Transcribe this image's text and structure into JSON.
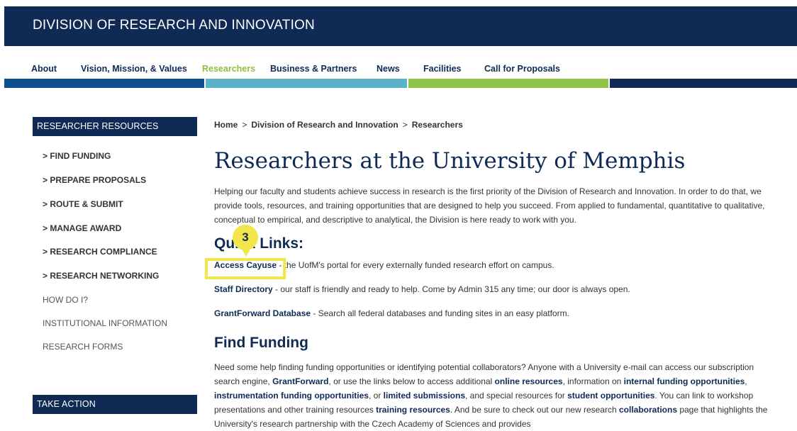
{
  "header": {
    "title": "DIVISION OF RESEARCH AND INNOVATION"
  },
  "nav": {
    "items": [
      {
        "label": "About"
      },
      {
        "label": "Vision, Mission, & Values"
      },
      {
        "label": "Researchers"
      },
      {
        "label": "Business & Partners"
      },
      {
        "label": "News"
      },
      {
        "label": "Facilities"
      },
      {
        "label": "Call for Proposals"
      }
    ],
    "active": "Researchers"
  },
  "stripes": {
    "colors": [
      "#0e4f8f",
      "#5cb3c9",
      "#8fc449",
      "#0e2a55"
    ]
  },
  "sidebar": {
    "heading": "RESEARCHER RESOURCES",
    "items": [
      {
        "label": "> FIND FUNDING"
      },
      {
        "label": "> PREPARE PROPOSALS"
      },
      {
        "label": "> ROUTE & SUBMIT"
      },
      {
        "label": "> MANAGE AWARD"
      },
      {
        "label": "> RESEARCH COMPLIANCE"
      },
      {
        "label": "> RESEARCH NETWORKING"
      },
      {
        "label": "HOW DO I?"
      },
      {
        "label": "INSTITUTIONAL INFORMATION"
      },
      {
        "label": "RESEARCH FORMS"
      }
    ],
    "take_action": "TAKE ACTION"
  },
  "breadcrumb": {
    "items": [
      "Home",
      "Division of Research and Innovation",
      "Researchers"
    ],
    "separator": ">"
  },
  "main": {
    "title": "Researchers at the University of Memphis",
    "intro": "Helping our faculty and students achieve success in research is the first priority of the Division of Research and Innovation. In order to do that, we provide tools, resources, and training opportunities that are designed to help you succeed. From applied to fundamental, quantitative to qualitative, conceptual to empirical, and descriptive to analytical, the Division is here ready to work with you.",
    "quick_links_heading": "Quick Links:",
    "quick_links": [
      {
        "link": "Access Cayuse",
        "text": " - the UofM's portal for every externally funded research effort on campus."
      },
      {
        "link": "Staff Directory",
        "text": " - our staff is friendly and ready to help.  Come by Admin 315 any time; our door is always open."
      },
      {
        "link": "GrantForward Database",
        "text": " - Search all federal databases and funding sites in an easy platform."
      }
    ],
    "find_funding_heading": "Find Funding",
    "ff": {
      "t1": "Need some help finding funding opportunities or identifying potential collaborators? Anyone with a University e-mail can access our subscription search engine, ",
      "l1": "GrantForward",
      "t2": ", or use the links below to access additional ",
      "l2": "online resources",
      "t3": ", information on ",
      "l3": "internal funding opportunities",
      "t4": ", ",
      "l4": "instrumentation funding opportunities",
      "t5": ", or ",
      "l5": "limited submissions",
      "t6": ", and special resources for ",
      "l6": "student opportunities",
      "t7": ". You can link to workshop presentations and other training resources ",
      "l7": "training resources",
      "t8": ". And be sure to check out our new research ",
      "l8": "collaborations",
      "t9": " page that highlights the University's research partnership with the Czech Academy of Sciences and provides"
    }
  },
  "annotation": {
    "marker_number": "3",
    "highlight_color": "#f1e64a"
  }
}
